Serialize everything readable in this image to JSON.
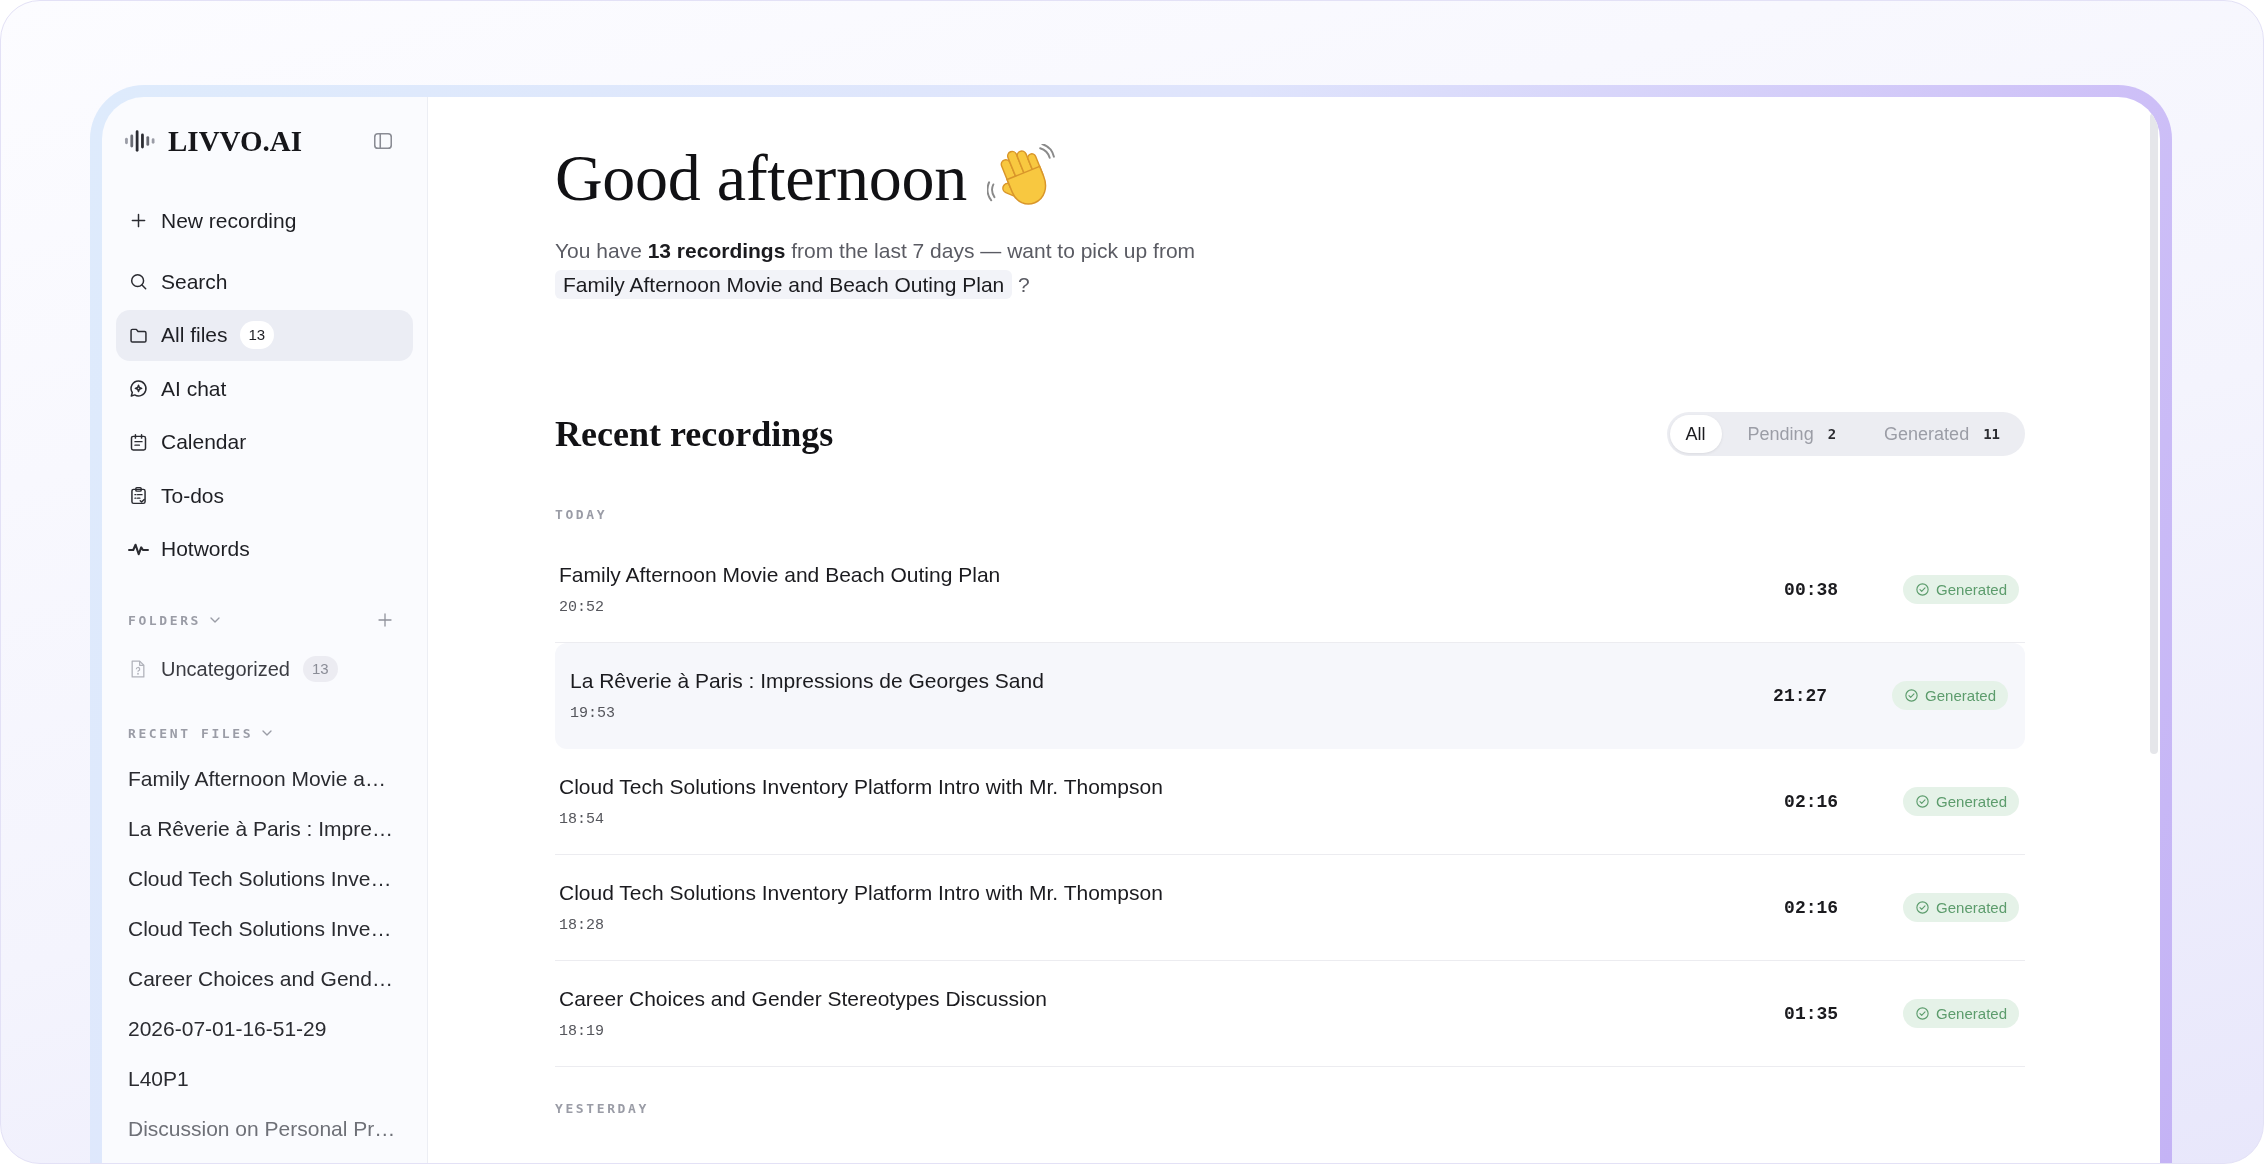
{
  "sidebar": {
    "logo": "LIVVO.AI",
    "nav": [
      {
        "label": "New recording",
        "selected": false
      },
      {
        "label": "Search",
        "selected": false
      },
      {
        "label": "All files",
        "count": "13",
        "selected": true
      },
      {
        "label": "AI chat",
        "selected": false
      },
      {
        "label": "Calendar",
        "selected": false
      },
      {
        "label": "To-dos",
        "selected": false
      },
      {
        "label": "Hotwords",
        "selected": false
      }
    ],
    "folders": {
      "title": "FOLDERS",
      "expanded": true,
      "items": [
        {
          "label": "Uncategorized",
          "count": "13"
        }
      ]
    },
    "recent_files": {
      "title": "RECENT FILES",
      "expanded": true,
      "items": [
        "Family Afternoon Movie a…",
        "La Rêverie à Paris : Impre…",
        "Cloud Tech Solutions Inve…",
        "Cloud Tech Solutions Inve…",
        "Career Choices and Gend…",
        "2026-07-01-16-51-29",
        "L40P1",
        "Discussion on Personal Pr…"
      ]
    }
  },
  "main": {
    "greeting": {
      "title": "Good afternoon",
      "message": "You have **13 recordings** from the last 7 days — want to pick up from",
      "link": "Family Afternoon Movie and Beach Outing Plan",
      "message_end": "?"
    },
    "section_title": "Recent recordings",
    "filters": [
      {
        "label": "All",
        "selected": true
      },
      {
        "label": "Pending",
        "count": "2",
        "selected": false
      },
      {
        "label": "Generated",
        "count": "11",
        "selected": false
      }
    ],
    "groups": [
      {
        "label": "TODAY",
        "recordings": [
          {
            "title": "Family Afternoon Movie and Beach Outing Plan",
            "time": "20:52",
            "duration": "00:38",
            "status": "Generated",
            "highlighted": false
          },
          {
            "title": "La Rêverie à Paris : Impressions de Georges Sand",
            "time": "19:53",
            "duration": "21:27",
            "status": "Generated",
            "highlighted": true
          },
          {
            "title": "Cloud Tech Solutions Inventory Platform Intro with Mr. Thompson",
            "time": "18:54",
            "duration": "02:16",
            "status": "Generated",
            "highlighted": false
          },
          {
            "title": "Cloud Tech Solutions Inventory Platform Intro with Mr. Thompson",
            "time": "18:28",
            "duration": "02:16",
            "status": "Generated",
            "highlighted": false
          },
          {
            "title": "Career Choices and Gender Stereotypes Discussion",
            "time": "18:19",
            "duration": "01:35",
            "status": "Generated",
            "highlighted": false
          }
        ]
      },
      {
        "label": "YESTERDAY"
      }
    ]
  }
}
